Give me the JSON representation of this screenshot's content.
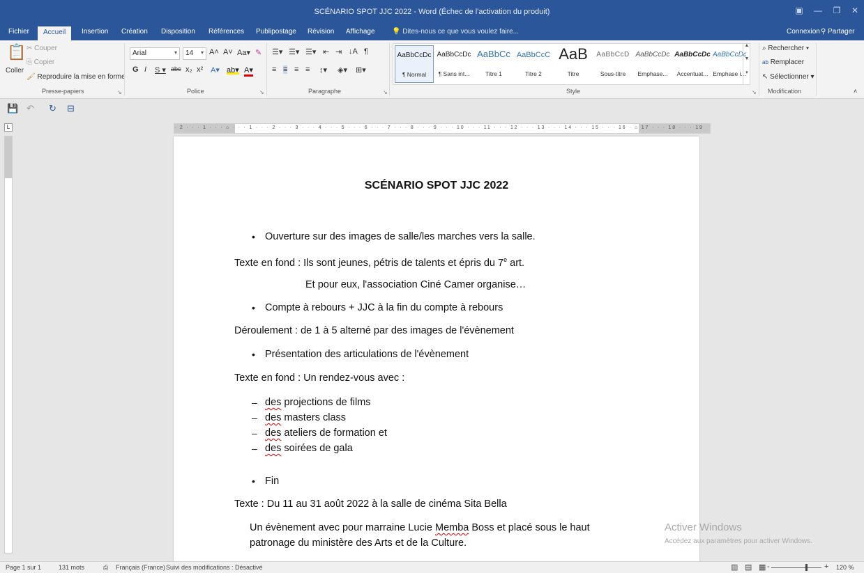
{
  "window": {
    "title": "SCÉNARIO SPOT JJC 2022 - Word (Échec de l'activation du produit)"
  },
  "tabs": [
    {
      "label": "Fichier"
    },
    {
      "label": "Accueil"
    },
    {
      "label": "Insertion"
    },
    {
      "label": "Création"
    },
    {
      "label": "Disposition"
    },
    {
      "label": "Références"
    },
    {
      "label": "Publipostage"
    },
    {
      "label": "Révision"
    },
    {
      "label": "Affichage"
    }
  ],
  "tell_me": "Dites-nous ce que vous voulez faire...",
  "account": {
    "signin": "Connexion",
    "share": "Partager"
  },
  "ribbon": {
    "clipboard": {
      "paste": "Coller",
      "cut": "Couper",
      "copy": "Copier",
      "format_painter": "Reproduire la mise en forme",
      "label": "Presse-papiers"
    },
    "font": {
      "name": "Arial",
      "size": "14",
      "label": "Police"
    },
    "paragraph": {
      "label": "Paragraphe"
    },
    "styles": {
      "label": "Style",
      "items": [
        {
          "preview": "AaBbCcDc",
          "name": "¶ Normal"
        },
        {
          "preview": "AaBbCcDc",
          "name": "¶ Sans int..."
        },
        {
          "preview": "AaBbCc",
          "name": "Titre 1"
        },
        {
          "preview": "AaBbCcC",
          "name": "Titre 2"
        },
        {
          "preview": "AaB",
          "name": "Titre"
        },
        {
          "preview": "AaBbCcD",
          "name": "Sous-titre"
        },
        {
          "preview": "AaBbCcDc",
          "name": "Emphase..."
        },
        {
          "preview": "AaBbCcDc",
          "name": "Accentuat..."
        },
        {
          "preview": "AaBbCcDc",
          "name": "Emphase i..."
        }
      ]
    },
    "editing": {
      "find": "Rechercher",
      "replace": "Remplacer",
      "select": "Sélectionner",
      "label": "Modification"
    }
  },
  "document": {
    "title": "SCÉNARIO SPOT JJC 2022",
    "lines": {
      "l1": "Ouverture sur des images de salle/les marches vers la salle.",
      "l2a": "Texte en fond : Ils sont jeunes, pétris de talents et épris du 7",
      "l2sup": "e",
      "l2b": " art.",
      "l3": "Et pour eux, l'association Ciné Camer organise…",
      "l4": "Compte à rebours + JJC à la fin du compte à rebours",
      "l5": "Déroulement : de 1 à 5 alterné par des images de l'évènement",
      "l6": "Présentation des articulations de l'évènement",
      "l7": "Texte en fond : Un rendez-vous avec :",
      "d1a": "des",
      "d1b": " projections de films",
      "d2a": "des",
      "d2b": " masters class",
      "d3a": "des",
      "d3b": " ateliers de formation et",
      "d4a": "des",
      "d4b": " soirées de gala",
      "l8": "Fin",
      "l9": "Texte : Du 11 au 31 août 2022 à la salle de cinéma Sita Bella",
      "l10a": "Un évènement avec pour marraine Lucie ",
      "l10b": "Memba",
      "l10c": " Boss et placé sous le haut",
      "l11": "patronage du ministère des Arts et de la Culture."
    }
  },
  "watermark": {
    "title": "Activer Windows",
    "subtitle": "Accédez aux paramètres pour activer Windows."
  },
  "status": {
    "page": "Page 1 sur 1",
    "words": "131 mots",
    "language": "Français (France)",
    "track_changes": "Suivi des modifications : Désactivé",
    "zoom": "120 %"
  }
}
